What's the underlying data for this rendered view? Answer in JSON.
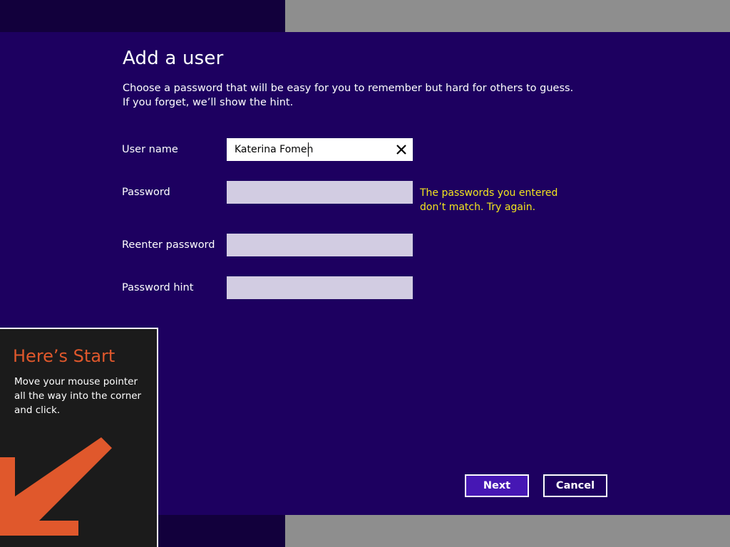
{
  "dialog": {
    "title": "Add a user",
    "description": "Choose a password that will be easy for you to remember but hard for others to guess. If you forget, we’ll show the hint."
  },
  "fields": {
    "username": {
      "label": "User name",
      "value": "Katerina Fomen"
    },
    "password": {
      "label": "Password",
      "value": ""
    },
    "reenter": {
      "label": "Reenter password",
      "value": ""
    },
    "hint": {
      "label": "Password hint",
      "value": ""
    }
  },
  "error": {
    "message": "The passwords you entered don’t match. Try again."
  },
  "buttons": {
    "next": "Next",
    "cancel": "Cancel"
  },
  "start_tip": {
    "title": "Here’s Start",
    "body": "Move your mouse pointer all the way into the corner and click."
  },
  "colors": {
    "dialog_background": "#1d0060",
    "primary_button": "#4617b4",
    "error_text": "#f2e51e",
    "tip_title": "#e0582c",
    "tip_arrow": "#e0582c"
  },
  "icons": {
    "clear": "close-icon",
    "tip_arrow": "arrow-down-left-icon"
  }
}
